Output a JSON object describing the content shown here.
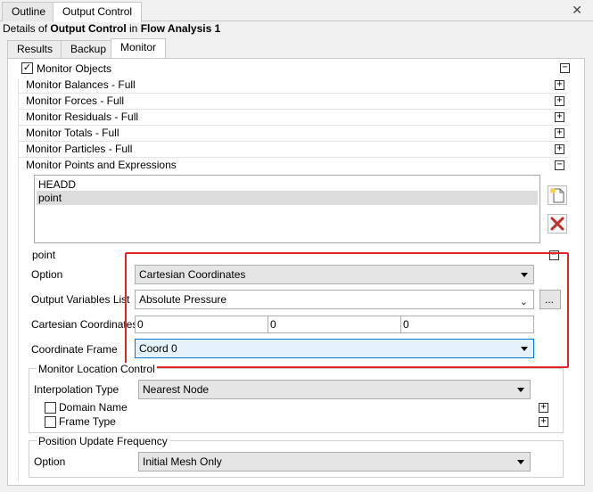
{
  "top_tabs": [
    "Outline",
    "Output Control"
  ],
  "details": {
    "prefix": "Details of ",
    "object": "Output Control",
    "mid": " in ",
    "analysis": "Flow Analysis 1"
  },
  "sub_tabs": [
    "Results",
    "Backup",
    "Monitor"
  ],
  "monitor_objects": {
    "label": "Monitor Objects",
    "checked": true
  },
  "sections": [
    "Monitor Balances - Full",
    "Monitor Forces - Full",
    "Monitor Residuals - Full",
    "Monitor Totals - Full",
    "Monitor Particles - Full",
    "Monitor Points and Expressions"
  ],
  "points_list": [
    "HEADD",
    "point"
  ],
  "selected_point": "point",
  "point_form": {
    "option_label": "Option",
    "option_value": "Cartesian Coordinates",
    "output_vars_label": "Output Variables List",
    "output_vars_value": "Absolute Pressure",
    "ellipsis": "...",
    "cartesian_label": "Cartesian Coordinates",
    "coords": [
      "0",
      "0",
      "0"
    ],
    "frame_label": "Coordinate Frame",
    "frame_value": "Coord 0"
  },
  "location_control": {
    "title": "Monitor Location Control",
    "interp_label": "Interpolation Type",
    "interp_value": "Nearest Node",
    "domain_name": "Domain Name",
    "frame_type": "Frame Type"
  },
  "update_freq": {
    "title": "Position Update Frequency",
    "option_label": "Option",
    "option_value": "Initial Mesh Only"
  },
  "icons": {
    "close": "close-icon",
    "new": "new-item-icon",
    "delete": "delete-icon"
  },
  "colors": {
    "highlight_border": "#e32424",
    "focus_border": "#0078d7",
    "delete_red": "#c0302a"
  }
}
